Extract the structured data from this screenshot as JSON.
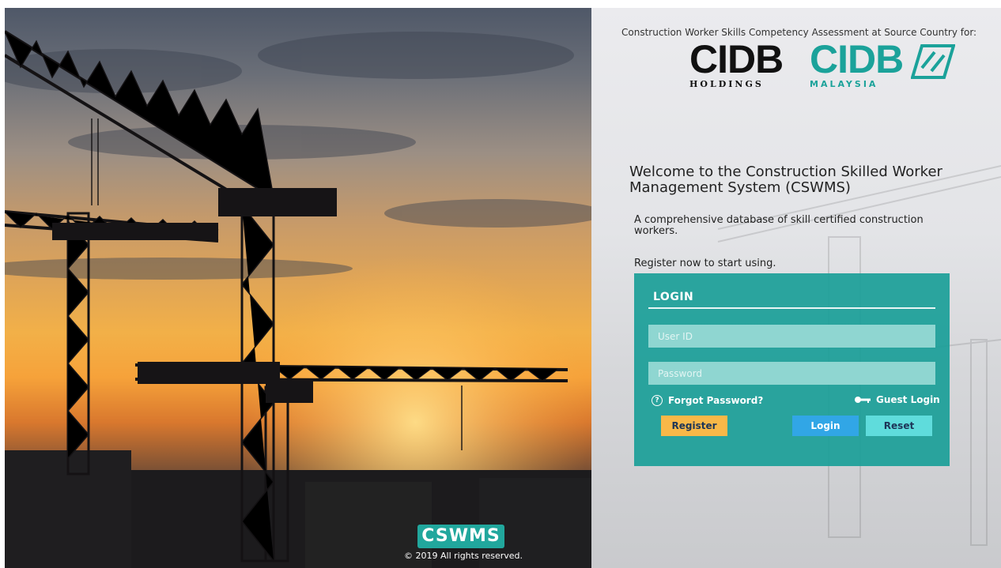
{
  "header": {
    "source_text": "Construction Worker Skills Competency Assessment at Source Country for:",
    "logo1": {
      "main": "CIDB",
      "sub": "HOLDINGS"
    },
    "logo2": {
      "main": "CIDB",
      "sub": "MALAYSIA"
    }
  },
  "welcome": {
    "title": "Welcome to the Construction Skilled Worker Management System (CSWMS)",
    "description": "A comprehensive database of skill certified construction workers.",
    "register_prompt": "Register now to start using."
  },
  "login": {
    "title": "LOGIN",
    "user_id_placeholder": "User ID",
    "password_placeholder": "Password",
    "forgot_password": "Forgot Password?",
    "guest_login": "Guest Login",
    "register_label": "Register",
    "login_label": "Login",
    "reset_label": "Reset"
  },
  "footer": {
    "logo_text": "CSWMS",
    "copyright": "© 2019 All rights reserved."
  },
  "colors": {
    "teal": "#1a9e98",
    "register_btn": "#f8b848",
    "login_btn": "#31a6e6",
    "reset_btn": "#5fdcdc"
  },
  "icons": [
    "help-icon",
    "key-icon",
    "crane-graphic"
  ]
}
